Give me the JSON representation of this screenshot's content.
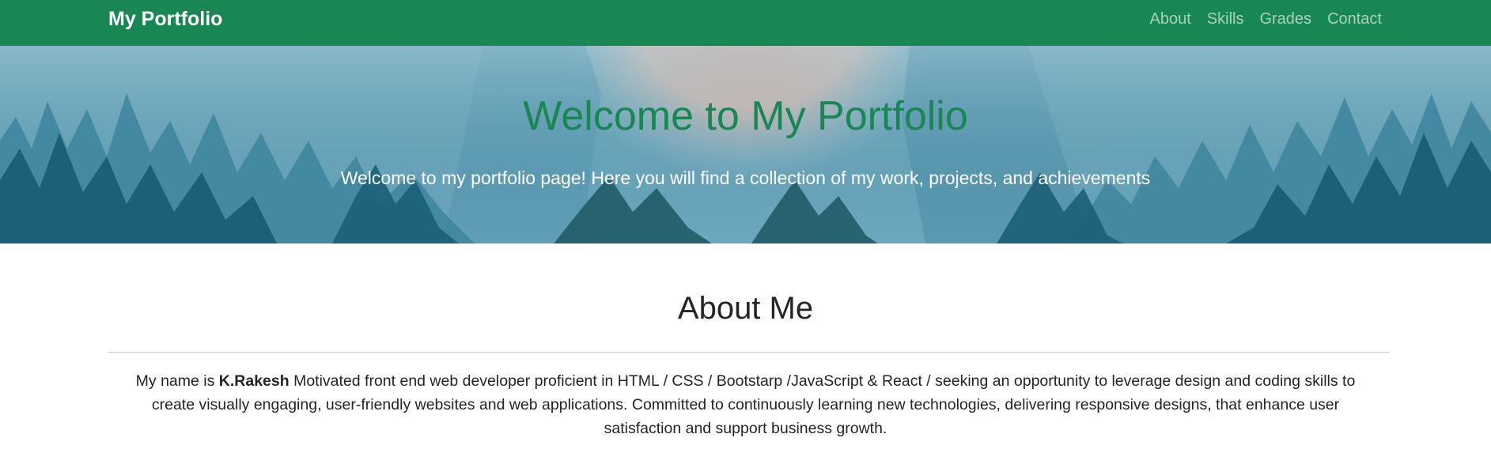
{
  "navbar": {
    "brand": "My Portfolio",
    "links": [
      {
        "label": "About"
      },
      {
        "label": "Skills"
      },
      {
        "label": "Grades"
      },
      {
        "label": "Contact"
      }
    ],
    "color": "#198754"
  },
  "hero": {
    "title": "Welcome to My Portfolio",
    "subtitle": "Welcome to my portfolio page! Here you will find a collection of my work, projects, and achievements"
  },
  "about": {
    "heading": "About Me",
    "intro": "My name is ",
    "name": "K.Rakesh",
    "text": " Motivated front end web developer proficient in HTML / CSS / Bootstarp /JavaScript & React / seeking an opportunity to leverage design and coding skills to create visually engaging, user-friendly websites and web applications. Committed to continuously learning new technologies, delivering responsive designs, that enhance user satisfaction and support business growth."
  }
}
